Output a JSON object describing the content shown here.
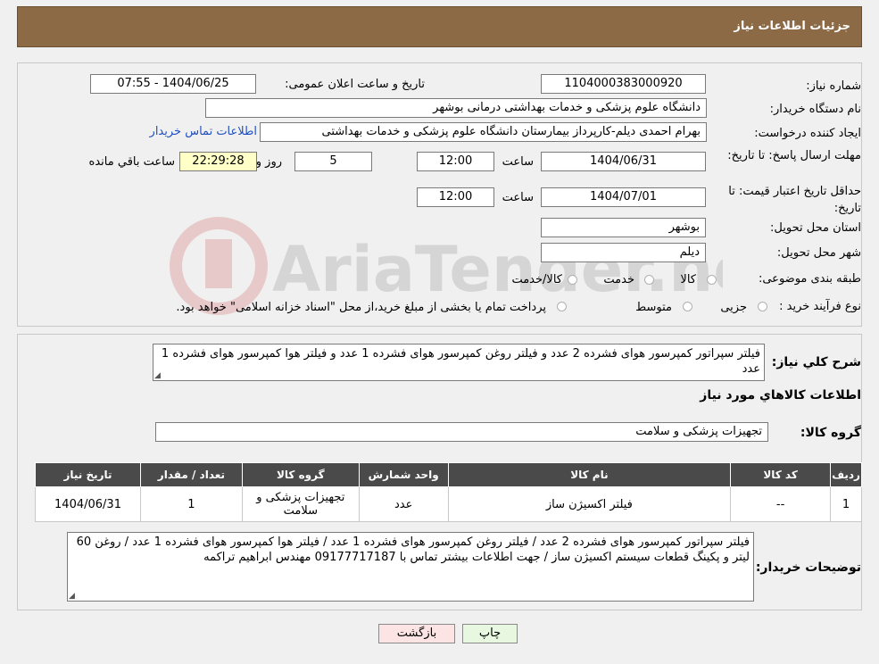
{
  "header": {
    "title": "جزئیات اطلاعات نیاز"
  },
  "form": {
    "need_number_label": "شماره نیاز:",
    "need_number": "1104000383000920",
    "announce_label": "تاریخ و ساعت اعلان عمومی:",
    "announce_value": "1404/06/25 - 07:55",
    "buyer_org_label": "نام دستگاه خریدار:",
    "buyer_org": "دانشگاه علوم پزشکی و خدمات بهداشتی درمانی بوشهر",
    "creator_label": "ایجاد کننده درخواست:",
    "creator": "بهرام احمدی دیلم-کارپرداز بیمارستان دانشگاه علوم پزشکی و خدمات بهداشتی",
    "contact_link": "اطلاعات تماس خریدار",
    "deadline_label": "مهلت ارسال پاسخ: تا تاریخ:",
    "deadline_date": "1404/06/31",
    "time_label": "ساعت",
    "deadline_time": "12:00",
    "days_value": "5",
    "days_label": "روز و",
    "remaining_time": "22:29:28",
    "remaining_label": "ساعت باقي مانده",
    "price_validity_label": "حداقل تاریخ اعتبار قیمت: تا تاریخ:",
    "price_validity_date": "1404/07/01",
    "price_validity_time": "12:00",
    "province_label": "استان محل تحویل:",
    "province": "بوشهر",
    "city_label": "شهر محل تحویل:",
    "city": "دیلم",
    "category_label": "طبقه بندی موضوعی:",
    "category_options": [
      "کالا",
      "خدمت",
      "کالا/خدمت"
    ],
    "process_label": "نوع فرآیند خرید :",
    "process_options": [
      "جزیی",
      "متوسط"
    ],
    "process_note": "پرداخت تمام یا بخشی از مبلغ خرید،از محل \"اسناد خزانه اسلامی\" خواهد بود."
  },
  "summary": {
    "label": "شرح کلي نياز:",
    "text": "فیلتر سپراتور کمپرسور هوای فشرده 2 عدد و فیلتر روغن کمپرسور هوای فشرده 1 عدد و فیلتر هوا کمپرسور هوای فشرده 1 عدد"
  },
  "goods_section_title": "اطلاعات کالاهاي مورد نياز",
  "goods_group": {
    "label": "گروه کالا:",
    "value": "تجهیزات پزشکی و سلامت"
  },
  "table": {
    "headers": [
      "ردیف",
      "کد کالا",
      "نام کالا",
      "واحد شمارش",
      "گروه کالا",
      "تعداد / مقدار",
      "تاریخ نیاز"
    ],
    "rows": [
      [
        "1",
        "--",
        "فیلتر اکسیژن ساز",
        "عدد",
        "تجهیزات پزشکی و سلامت",
        "1",
        "1404/06/31"
      ]
    ]
  },
  "buyer_notes": {
    "label": "توضیحات خریدار:",
    "text": "فیلتر سپراتور کمپرسور هوای فشرده 2 عدد / فیلتر روغن کمپرسور هوای فشرده 1 عدد / فیلتر هوا کمپرسور هوای فشرده 1 عدد / روغن 60 لیتر  و پکینگ قطعات سیستم اکسیژن ساز / جهت اطلاعات بیشتر تماس با 09177717187 مهندس ابراهیم تراکمه"
  },
  "buttons": {
    "print": "چاپ",
    "back": "بازگشت"
  },
  "watermark_text": "AriaTender.neT",
  "colors": {
    "header_bg": "#8b6a45",
    "link": "#2050c0",
    "yellow_box": "#ffffc8",
    "table_header": "#4a4a4a"
  }
}
